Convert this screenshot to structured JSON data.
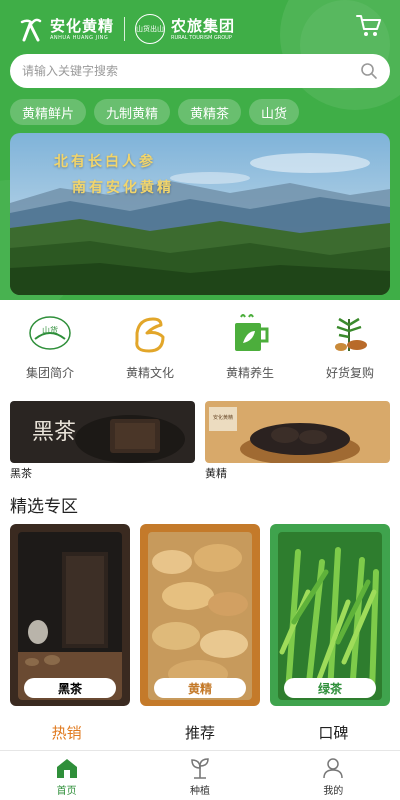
{
  "header": {
    "brand1": {
      "cn": "安化黄精",
      "en": "ANHUA HUANG JING"
    },
    "brand2": {
      "logo_text": "山货出山",
      "cn": "农旅集团",
      "en": "RURAL TOURISM GROUP"
    },
    "bg_color": "#3fae47"
  },
  "search": {
    "placeholder": "请输入关键字搜索"
  },
  "chips": [
    "黄精鲜片",
    "九制黄精",
    "黄精茶",
    "山货"
  ],
  "banner": {
    "line1": "北有长白人参",
    "line2": "南有安化黄精"
  },
  "features": [
    {
      "label": "集团简介",
      "icon": "group-logo-icon"
    },
    {
      "label": "黄精文化",
      "icon": "culture-icon"
    },
    {
      "label": "黄精养生",
      "icon": "tea-cup-icon"
    },
    {
      "label": "好货复购",
      "icon": "herb-icon"
    }
  ],
  "promos": [
    {
      "label": "黑茶",
      "img_text": "黑茶"
    },
    {
      "label": "黄精",
      "img_text": "安化黄精"
    }
  ],
  "section_title": "精选专区",
  "picks": [
    {
      "tag": "黑茶",
      "color": "#3a2a20"
    },
    {
      "tag": "黄精",
      "color": "#c47a2a"
    },
    {
      "tag": "绿茶",
      "color": "#3fa34d"
    }
  ],
  "tabs": [
    "热销",
    "推荐",
    "口碑"
  ],
  "active_tab": "热销",
  "bottom_nav": [
    {
      "label": "首页",
      "icon": "home-icon"
    },
    {
      "label": "种植",
      "icon": "plant-icon"
    },
    {
      "label": "我的",
      "icon": "user-icon"
    }
  ]
}
